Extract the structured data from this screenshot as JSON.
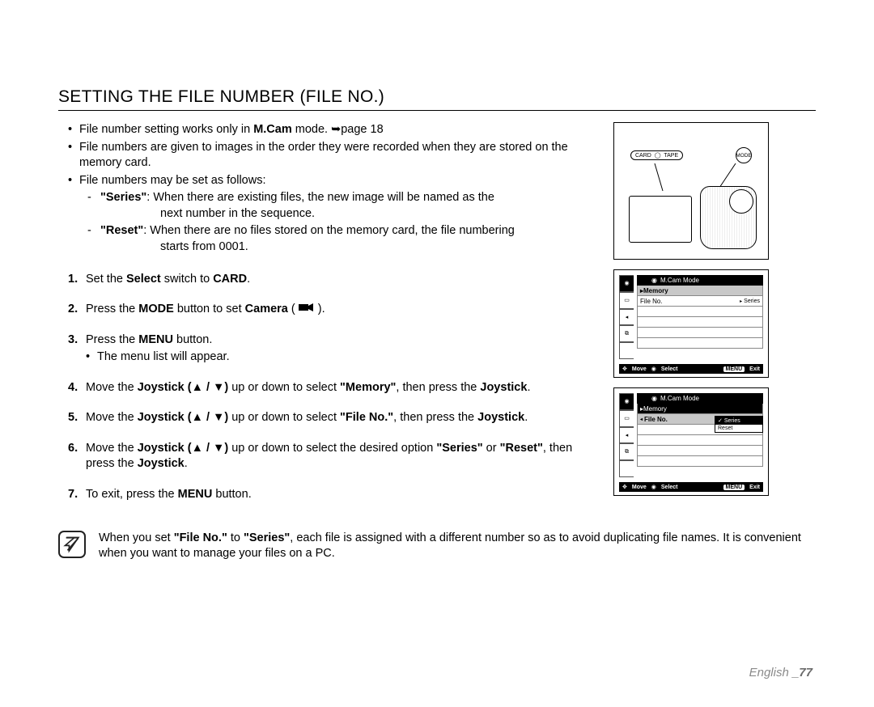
{
  "title": "SETTING THE FILE NUMBER (FILE NO.)",
  "bullets": {
    "b1a": "File number setting works only in",
    "b1b": "M.Cam",
    "b1c": "mode. ➥page 18",
    "b2": "File numbers are given to images in the order they were recorded when they are stored on the memory card.",
    "b3": "File numbers may be set as follows:"
  },
  "defs": {
    "series": {
      "term": "\"Series\"",
      "rest": ": When there are existing files, the new image will be named as the",
      "hang": "next number in the sequence."
    },
    "reset": {
      "term": "\"Reset\"",
      "rest": ": When there are no files stored on the memory card, the file numbering",
      "hang": "starts from 0001."
    }
  },
  "steps": {
    "s1a": "Set the",
    "s1b": "Select",
    "s1c": "switch to",
    "s1d": "CARD",
    "s1e": ".",
    "s2a": "Press the",
    "s2b": "MODE",
    "s2c": "button to set",
    "s2d": "Camera",
    "s2e": "(",
    "s2f": ").",
    "s3a": "Press the",
    "s3b": "MENU",
    "s3c": "button.",
    "s3sub": "The menu list will appear.",
    "s4a": "Move the",
    "s4b": "Joystick (▲ / ▼)",
    "s4c": "up or down to select",
    "s4d": "\"Memory\"",
    "s4e": ", then press the",
    "s4f": "Joystick",
    "s4g": ".",
    "s5a": "Move the",
    "s5b": "Joystick (▲ / ▼)",
    "s5c": "up or down to select",
    "s5d": "\"File No.\"",
    "s5e": ", then press the",
    "s5f": "Joystick",
    "s5g": ".",
    "s6a": "Move the",
    "s6b": "Joystick (▲ / ▼)",
    "s6c": "up or down to select the desired option",
    "s6d": "\"Series\"",
    "s6e": "or",
    "s6f": "\"Reset\"",
    "s6g": ", then press the",
    "s6h": "Joystick",
    "s6i": ".",
    "s7a": "To exit, press the",
    "s7b": "MENU",
    "s7c": "button."
  },
  "note": {
    "na": "When you set",
    "nb": "\"File No.\"",
    "nc": "to",
    "nd": "\"Series\"",
    "ne": ", each file is assigned with a different number so as to avoid duplicating file names. It is convenient when you want to manage your files on a PC."
  },
  "camera": {
    "card": "CARD",
    "tape": "TAPE",
    "mode": "MODE"
  },
  "menus": {
    "m1": {
      "mode": "M.Cam Mode",
      "cat": "Memory",
      "item": "File No.",
      "value": "Series",
      "footer": {
        "move": "Move",
        "select": "Select",
        "menu": "MENU",
        "exit": "Exit"
      }
    },
    "m2": {
      "mode": "M.Cam Mode",
      "cat": "Memory",
      "item": "File No.",
      "opts": {
        "o1": "Series",
        "o2": "Reset"
      },
      "footer": {
        "move": "Move",
        "select": "Select",
        "menu": "MENU",
        "exit": "Exit"
      }
    }
  },
  "footer": {
    "lang": "English",
    "page": "_77"
  }
}
